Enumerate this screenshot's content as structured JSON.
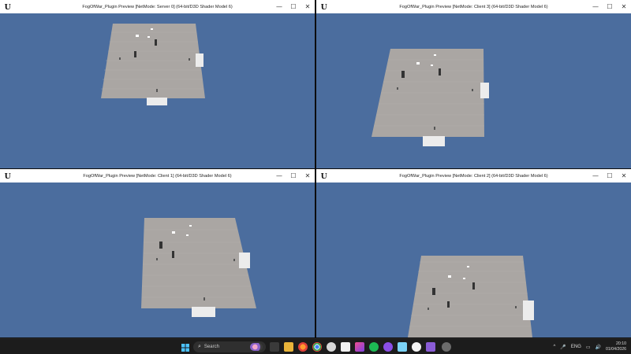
{
  "windows": [
    {
      "title": "FogOfWar_Plugin Preview [NetMode: Server 0]  (64-bit/D3D Shader Model 6)"
    },
    {
      "title": "FogOfWar_Plugin Preview [NetMode: Client 3]  (64-bit/D3D Shader Model 6)"
    },
    {
      "title": "FogOfWar_Plugin Preview [NetMode: Client 1]  (64-bit/D3D Shader Model 6)"
    },
    {
      "title": "FogOfWar_Plugin Preview [NetMode: Client 2]  (64-bit/D3D Shader Model 6)"
    }
  ],
  "window_controls": {
    "minimize": "—",
    "maximize": "☐",
    "close": "✕"
  },
  "colors": {
    "viewport_sky": "#4b6d9e",
    "floor": "#aaa6a3",
    "titlebar": "#ffffff",
    "taskbar": "#1c1c1c"
  },
  "taskbar": {
    "search_placeholder": "Search",
    "search_icon": "magnifier-icon",
    "tray": {
      "chevron": "^",
      "lang": "ENG",
      "time": "20:10",
      "date": "01/04/2026"
    },
    "apps": [
      "windows-start-icon",
      "file-explorer-icon",
      "browser-icon",
      "firefox-icon",
      "chrome-icon",
      "app-notification-icon",
      "notion-icon",
      "jetbrains-rider-icon",
      "spotify-icon",
      "proton-icon",
      "steam-icon",
      "unreal-engine-icon",
      "visual-studio-icon",
      "github-icon"
    ]
  }
}
